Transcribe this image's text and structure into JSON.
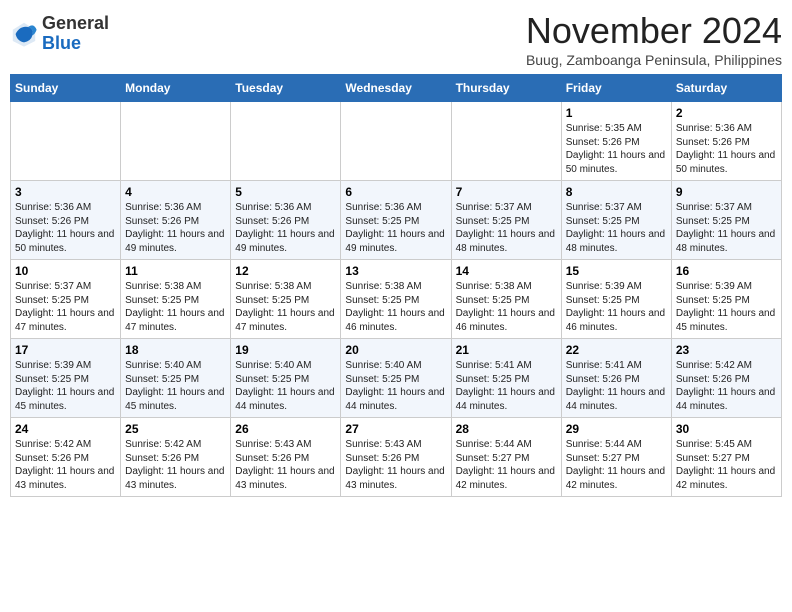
{
  "header": {
    "logo_general": "General",
    "logo_blue": "Blue",
    "month_title": "November 2024",
    "subtitle": "Buug, Zamboanga Peninsula, Philippines"
  },
  "weekdays": [
    "Sunday",
    "Monday",
    "Tuesday",
    "Wednesday",
    "Thursday",
    "Friday",
    "Saturday"
  ],
  "weeks": [
    [
      {
        "day": "",
        "info": ""
      },
      {
        "day": "",
        "info": ""
      },
      {
        "day": "",
        "info": ""
      },
      {
        "day": "",
        "info": ""
      },
      {
        "day": "",
        "info": ""
      },
      {
        "day": "1",
        "info": "Sunrise: 5:35 AM\nSunset: 5:26 PM\nDaylight: 11 hours and 50 minutes."
      },
      {
        "day": "2",
        "info": "Sunrise: 5:36 AM\nSunset: 5:26 PM\nDaylight: 11 hours and 50 minutes."
      }
    ],
    [
      {
        "day": "3",
        "info": "Sunrise: 5:36 AM\nSunset: 5:26 PM\nDaylight: 11 hours and 50 minutes."
      },
      {
        "day": "4",
        "info": "Sunrise: 5:36 AM\nSunset: 5:26 PM\nDaylight: 11 hours and 49 minutes."
      },
      {
        "day": "5",
        "info": "Sunrise: 5:36 AM\nSunset: 5:26 PM\nDaylight: 11 hours and 49 minutes."
      },
      {
        "day": "6",
        "info": "Sunrise: 5:36 AM\nSunset: 5:25 PM\nDaylight: 11 hours and 49 minutes."
      },
      {
        "day": "7",
        "info": "Sunrise: 5:37 AM\nSunset: 5:25 PM\nDaylight: 11 hours and 48 minutes."
      },
      {
        "day": "8",
        "info": "Sunrise: 5:37 AM\nSunset: 5:25 PM\nDaylight: 11 hours and 48 minutes."
      },
      {
        "day": "9",
        "info": "Sunrise: 5:37 AM\nSunset: 5:25 PM\nDaylight: 11 hours and 48 minutes."
      }
    ],
    [
      {
        "day": "10",
        "info": "Sunrise: 5:37 AM\nSunset: 5:25 PM\nDaylight: 11 hours and 47 minutes."
      },
      {
        "day": "11",
        "info": "Sunrise: 5:38 AM\nSunset: 5:25 PM\nDaylight: 11 hours and 47 minutes."
      },
      {
        "day": "12",
        "info": "Sunrise: 5:38 AM\nSunset: 5:25 PM\nDaylight: 11 hours and 47 minutes."
      },
      {
        "day": "13",
        "info": "Sunrise: 5:38 AM\nSunset: 5:25 PM\nDaylight: 11 hours and 46 minutes."
      },
      {
        "day": "14",
        "info": "Sunrise: 5:38 AM\nSunset: 5:25 PM\nDaylight: 11 hours and 46 minutes."
      },
      {
        "day": "15",
        "info": "Sunrise: 5:39 AM\nSunset: 5:25 PM\nDaylight: 11 hours and 46 minutes."
      },
      {
        "day": "16",
        "info": "Sunrise: 5:39 AM\nSunset: 5:25 PM\nDaylight: 11 hours and 45 minutes."
      }
    ],
    [
      {
        "day": "17",
        "info": "Sunrise: 5:39 AM\nSunset: 5:25 PM\nDaylight: 11 hours and 45 minutes."
      },
      {
        "day": "18",
        "info": "Sunrise: 5:40 AM\nSunset: 5:25 PM\nDaylight: 11 hours and 45 minutes."
      },
      {
        "day": "19",
        "info": "Sunrise: 5:40 AM\nSunset: 5:25 PM\nDaylight: 11 hours and 44 minutes."
      },
      {
        "day": "20",
        "info": "Sunrise: 5:40 AM\nSunset: 5:25 PM\nDaylight: 11 hours and 44 minutes."
      },
      {
        "day": "21",
        "info": "Sunrise: 5:41 AM\nSunset: 5:25 PM\nDaylight: 11 hours and 44 minutes."
      },
      {
        "day": "22",
        "info": "Sunrise: 5:41 AM\nSunset: 5:26 PM\nDaylight: 11 hours and 44 minutes."
      },
      {
        "day": "23",
        "info": "Sunrise: 5:42 AM\nSunset: 5:26 PM\nDaylight: 11 hours and 44 minutes."
      }
    ],
    [
      {
        "day": "24",
        "info": "Sunrise: 5:42 AM\nSunset: 5:26 PM\nDaylight: 11 hours and 43 minutes."
      },
      {
        "day": "25",
        "info": "Sunrise: 5:42 AM\nSunset: 5:26 PM\nDaylight: 11 hours and 43 minutes."
      },
      {
        "day": "26",
        "info": "Sunrise: 5:43 AM\nSunset: 5:26 PM\nDaylight: 11 hours and 43 minutes."
      },
      {
        "day": "27",
        "info": "Sunrise: 5:43 AM\nSunset: 5:26 PM\nDaylight: 11 hours and 43 minutes."
      },
      {
        "day": "28",
        "info": "Sunrise: 5:44 AM\nSunset: 5:27 PM\nDaylight: 11 hours and 42 minutes."
      },
      {
        "day": "29",
        "info": "Sunrise: 5:44 AM\nSunset: 5:27 PM\nDaylight: 11 hours and 42 minutes."
      },
      {
        "day": "30",
        "info": "Sunrise: 5:45 AM\nSunset: 5:27 PM\nDaylight: 11 hours and 42 minutes."
      }
    ]
  ]
}
